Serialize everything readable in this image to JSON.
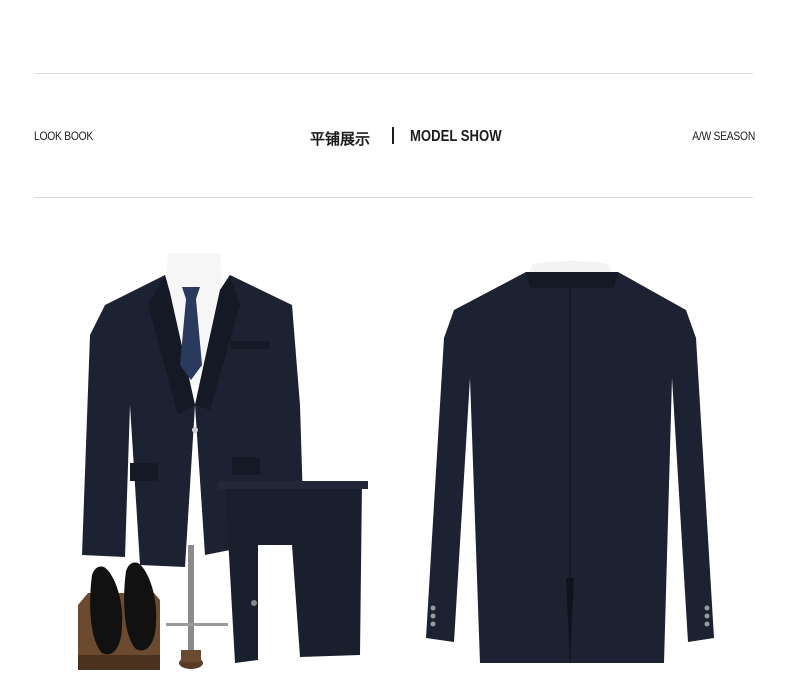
{
  "header": {
    "left_label": "LOOK BOOK",
    "title_cn": "平铺展示",
    "title_en": "MODEL SHOW",
    "right_label": "A/W SEASON"
  },
  "colors": {
    "suit": "#1d2232",
    "suit_shadow": "#11141f",
    "shirt": "#f6f6f6",
    "tie": "#2a3a5e",
    "wood": "#6b4a2f",
    "rule": "#d9d9d9"
  },
  "images": {
    "front_suit": "front-suit-photo",
    "back_suit": "back-jacket-photo"
  }
}
